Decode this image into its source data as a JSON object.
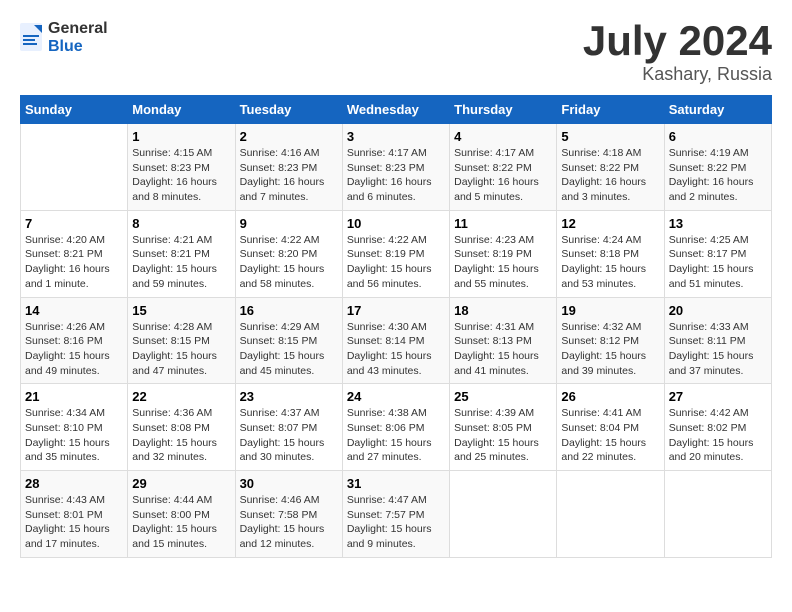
{
  "logo": {
    "text_general": "General",
    "text_blue": "Blue"
  },
  "title": {
    "month_year": "July 2024",
    "location": "Kashary, Russia"
  },
  "headers": [
    "Sunday",
    "Monday",
    "Tuesday",
    "Wednesday",
    "Thursday",
    "Friday",
    "Saturday"
  ],
  "weeks": [
    [
      {
        "day": "",
        "sunrise": "",
        "sunset": "",
        "daylight": ""
      },
      {
        "day": "1",
        "sunrise": "Sunrise: 4:15 AM",
        "sunset": "Sunset: 8:23 PM",
        "daylight": "Daylight: 16 hours and 8 minutes."
      },
      {
        "day": "2",
        "sunrise": "Sunrise: 4:16 AM",
        "sunset": "Sunset: 8:23 PM",
        "daylight": "Daylight: 16 hours and 7 minutes."
      },
      {
        "day": "3",
        "sunrise": "Sunrise: 4:17 AM",
        "sunset": "Sunset: 8:23 PM",
        "daylight": "Daylight: 16 hours and 6 minutes."
      },
      {
        "day": "4",
        "sunrise": "Sunrise: 4:17 AM",
        "sunset": "Sunset: 8:22 PM",
        "daylight": "Daylight: 16 hours and 5 minutes."
      },
      {
        "day": "5",
        "sunrise": "Sunrise: 4:18 AM",
        "sunset": "Sunset: 8:22 PM",
        "daylight": "Daylight: 16 hours and 3 minutes."
      },
      {
        "day": "6",
        "sunrise": "Sunrise: 4:19 AM",
        "sunset": "Sunset: 8:22 PM",
        "daylight": "Daylight: 16 hours and 2 minutes."
      }
    ],
    [
      {
        "day": "7",
        "sunrise": "Sunrise: 4:20 AM",
        "sunset": "Sunset: 8:21 PM",
        "daylight": "Daylight: 16 hours and 1 minute."
      },
      {
        "day": "8",
        "sunrise": "Sunrise: 4:21 AM",
        "sunset": "Sunset: 8:21 PM",
        "daylight": "Daylight: 15 hours and 59 minutes."
      },
      {
        "day": "9",
        "sunrise": "Sunrise: 4:22 AM",
        "sunset": "Sunset: 8:20 PM",
        "daylight": "Daylight: 15 hours and 58 minutes."
      },
      {
        "day": "10",
        "sunrise": "Sunrise: 4:22 AM",
        "sunset": "Sunset: 8:19 PM",
        "daylight": "Daylight: 15 hours and 56 minutes."
      },
      {
        "day": "11",
        "sunrise": "Sunrise: 4:23 AM",
        "sunset": "Sunset: 8:19 PM",
        "daylight": "Daylight: 15 hours and 55 minutes."
      },
      {
        "day": "12",
        "sunrise": "Sunrise: 4:24 AM",
        "sunset": "Sunset: 8:18 PM",
        "daylight": "Daylight: 15 hours and 53 minutes."
      },
      {
        "day": "13",
        "sunrise": "Sunrise: 4:25 AM",
        "sunset": "Sunset: 8:17 PM",
        "daylight": "Daylight: 15 hours and 51 minutes."
      }
    ],
    [
      {
        "day": "14",
        "sunrise": "Sunrise: 4:26 AM",
        "sunset": "Sunset: 8:16 PM",
        "daylight": "Daylight: 15 hours and 49 minutes."
      },
      {
        "day": "15",
        "sunrise": "Sunrise: 4:28 AM",
        "sunset": "Sunset: 8:15 PM",
        "daylight": "Daylight: 15 hours and 47 minutes."
      },
      {
        "day": "16",
        "sunrise": "Sunrise: 4:29 AM",
        "sunset": "Sunset: 8:15 PM",
        "daylight": "Daylight: 15 hours and 45 minutes."
      },
      {
        "day": "17",
        "sunrise": "Sunrise: 4:30 AM",
        "sunset": "Sunset: 8:14 PM",
        "daylight": "Daylight: 15 hours and 43 minutes."
      },
      {
        "day": "18",
        "sunrise": "Sunrise: 4:31 AM",
        "sunset": "Sunset: 8:13 PM",
        "daylight": "Daylight: 15 hours and 41 minutes."
      },
      {
        "day": "19",
        "sunrise": "Sunrise: 4:32 AM",
        "sunset": "Sunset: 8:12 PM",
        "daylight": "Daylight: 15 hours and 39 minutes."
      },
      {
        "day": "20",
        "sunrise": "Sunrise: 4:33 AM",
        "sunset": "Sunset: 8:11 PM",
        "daylight": "Daylight: 15 hours and 37 minutes."
      }
    ],
    [
      {
        "day": "21",
        "sunrise": "Sunrise: 4:34 AM",
        "sunset": "Sunset: 8:10 PM",
        "daylight": "Daylight: 15 hours and 35 minutes."
      },
      {
        "day": "22",
        "sunrise": "Sunrise: 4:36 AM",
        "sunset": "Sunset: 8:08 PM",
        "daylight": "Daylight: 15 hours and 32 minutes."
      },
      {
        "day": "23",
        "sunrise": "Sunrise: 4:37 AM",
        "sunset": "Sunset: 8:07 PM",
        "daylight": "Daylight: 15 hours and 30 minutes."
      },
      {
        "day": "24",
        "sunrise": "Sunrise: 4:38 AM",
        "sunset": "Sunset: 8:06 PM",
        "daylight": "Daylight: 15 hours and 27 minutes."
      },
      {
        "day": "25",
        "sunrise": "Sunrise: 4:39 AM",
        "sunset": "Sunset: 8:05 PM",
        "daylight": "Daylight: 15 hours and 25 minutes."
      },
      {
        "day": "26",
        "sunrise": "Sunrise: 4:41 AM",
        "sunset": "Sunset: 8:04 PM",
        "daylight": "Daylight: 15 hours and 22 minutes."
      },
      {
        "day": "27",
        "sunrise": "Sunrise: 4:42 AM",
        "sunset": "Sunset: 8:02 PM",
        "daylight": "Daylight: 15 hours and 20 minutes."
      }
    ],
    [
      {
        "day": "28",
        "sunrise": "Sunrise: 4:43 AM",
        "sunset": "Sunset: 8:01 PM",
        "daylight": "Daylight: 15 hours and 17 minutes."
      },
      {
        "day": "29",
        "sunrise": "Sunrise: 4:44 AM",
        "sunset": "Sunset: 8:00 PM",
        "daylight": "Daylight: 15 hours and 15 minutes."
      },
      {
        "day": "30",
        "sunrise": "Sunrise: 4:46 AM",
        "sunset": "Sunset: 7:58 PM",
        "daylight": "Daylight: 15 hours and 12 minutes."
      },
      {
        "day": "31",
        "sunrise": "Sunrise: 4:47 AM",
        "sunset": "Sunset: 7:57 PM",
        "daylight": "Daylight: 15 hours and 9 minutes."
      },
      {
        "day": "",
        "sunrise": "",
        "sunset": "",
        "daylight": ""
      },
      {
        "day": "",
        "sunrise": "",
        "sunset": "",
        "daylight": ""
      },
      {
        "day": "",
        "sunrise": "",
        "sunset": "",
        "daylight": ""
      }
    ]
  ]
}
